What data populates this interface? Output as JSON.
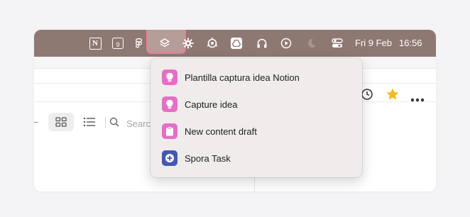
{
  "menubar": {
    "icons": [
      "notion-icon",
      "calendar-icon",
      "figma-icon",
      "layers-icon",
      "gear-icon",
      "target-icon",
      "drive-icon",
      "headphones-icon",
      "play-icon",
      "moon-icon",
      "toggles-icon"
    ],
    "calendar_day": "9",
    "notion_letter": "N",
    "date": "Fri 9 Feb",
    "time": "16:56"
  },
  "toolbar": {
    "search_placeholder": "Search"
  },
  "dropdown": {
    "items": [
      {
        "label": "Plantilla captura idea Notion",
        "icon": "lightbulb-icon",
        "color": "#e56fc7"
      },
      {
        "label": "Capture idea",
        "icon": "lightbulb-icon",
        "color": "#e56fc7"
      },
      {
        "label": "New content draft",
        "icon": "clipboard-icon",
        "color": "#e56fc7"
      },
      {
        "label": "Spora Task",
        "icon": "plus-circle-icon",
        "color": "#4457b3"
      }
    ]
  },
  "colors": {
    "menubar": "#8e7872",
    "highlight_border": "#f07c9a",
    "star": "#f2b928"
  }
}
